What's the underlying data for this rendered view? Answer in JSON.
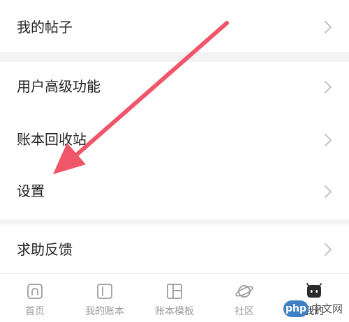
{
  "menu": {
    "my_posts": "我的帖子",
    "advanced_features": "用户高级功能",
    "recycle_bin": "账本回收站",
    "settings": "设置",
    "help_feedback": "求助反馈"
  },
  "tabbar": {
    "home": "首页",
    "my_ledgers": "我的账本",
    "templates": "账本模板",
    "community": "社区",
    "mine": "我的",
    "active": "mine"
  },
  "watermark": {
    "badge": "php",
    "text": "中文网"
  },
  "colors": {
    "arrow": "#f0566a",
    "background": "#f3f3f3",
    "card": "#ffffff",
    "label": "#222222",
    "inactive_tab": "#9a9a9a",
    "chevron": "#c2c2c2"
  },
  "icons": {
    "row_chevron": "chevron-right-icon",
    "home_tab": "home-icon",
    "ledger_tab": "ledger-book-icon",
    "template_tab": "template-grid-icon",
    "community_tab": "planet-icon",
    "mine_tab": "robot-face-icon"
  }
}
